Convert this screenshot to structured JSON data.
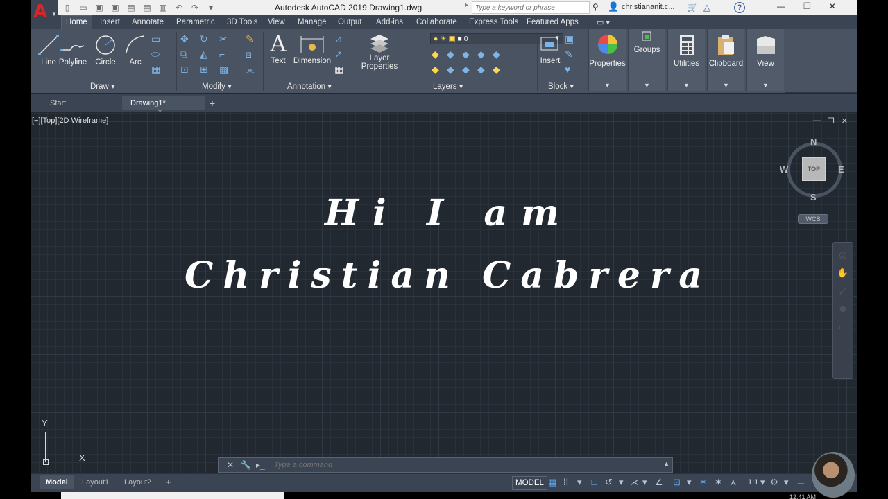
{
  "window": {
    "title": "Autodesk AutoCAD 2019   Drawing1.dwg",
    "search_placeholder": "Type a keyword or phrase",
    "user": "christiananit.c...",
    "app_letter": "A"
  },
  "ribbon_tabs": [
    "Home",
    "Insert",
    "Annotate",
    "Parametric",
    "3D Tools",
    "View",
    "Manage",
    "Output",
    "Add-ins",
    "Collaborate",
    "Express Tools",
    "Featured Apps"
  ],
  "ribbon": {
    "draw": {
      "title": "Draw",
      "tools": [
        "Line",
        "Polyline",
        "Circle",
        "Arc"
      ]
    },
    "modify": {
      "title": "Modify"
    },
    "annotation": {
      "title": "Annotation",
      "text": "Text",
      "dimension": "Dimension"
    },
    "layers": {
      "title": "Layers",
      "layer_properties_1": "Layer",
      "layer_properties_2": "Properties",
      "current_layer": "0"
    },
    "block": {
      "title": "Block",
      "insert": "Insert"
    },
    "properties": "Properties",
    "groups": "Groups",
    "utilities": "Utilities",
    "clipboard": "Clipboard",
    "view": "View"
  },
  "file_tabs": {
    "start": "Start",
    "drawing": "Drawing1*"
  },
  "viewport": {
    "label": "[−][Top][2D Wireframe]",
    "text_line1": "Hi I am",
    "text_line2": "Christian Cabrera"
  },
  "viewcube": {
    "n": "N",
    "s": "S",
    "e": "E",
    "w": "W",
    "top": "TOP",
    "wcs": "WCS"
  },
  "ucs": {
    "x": "X",
    "y": "Y"
  },
  "command_line": {
    "placeholder": "Type a command"
  },
  "layout_tabs": [
    "Model",
    "Layout1",
    "Layout2"
  ],
  "status": {
    "model": "MODEL",
    "scale": "1:1"
  },
  "clock": "12:41 AM"
}
